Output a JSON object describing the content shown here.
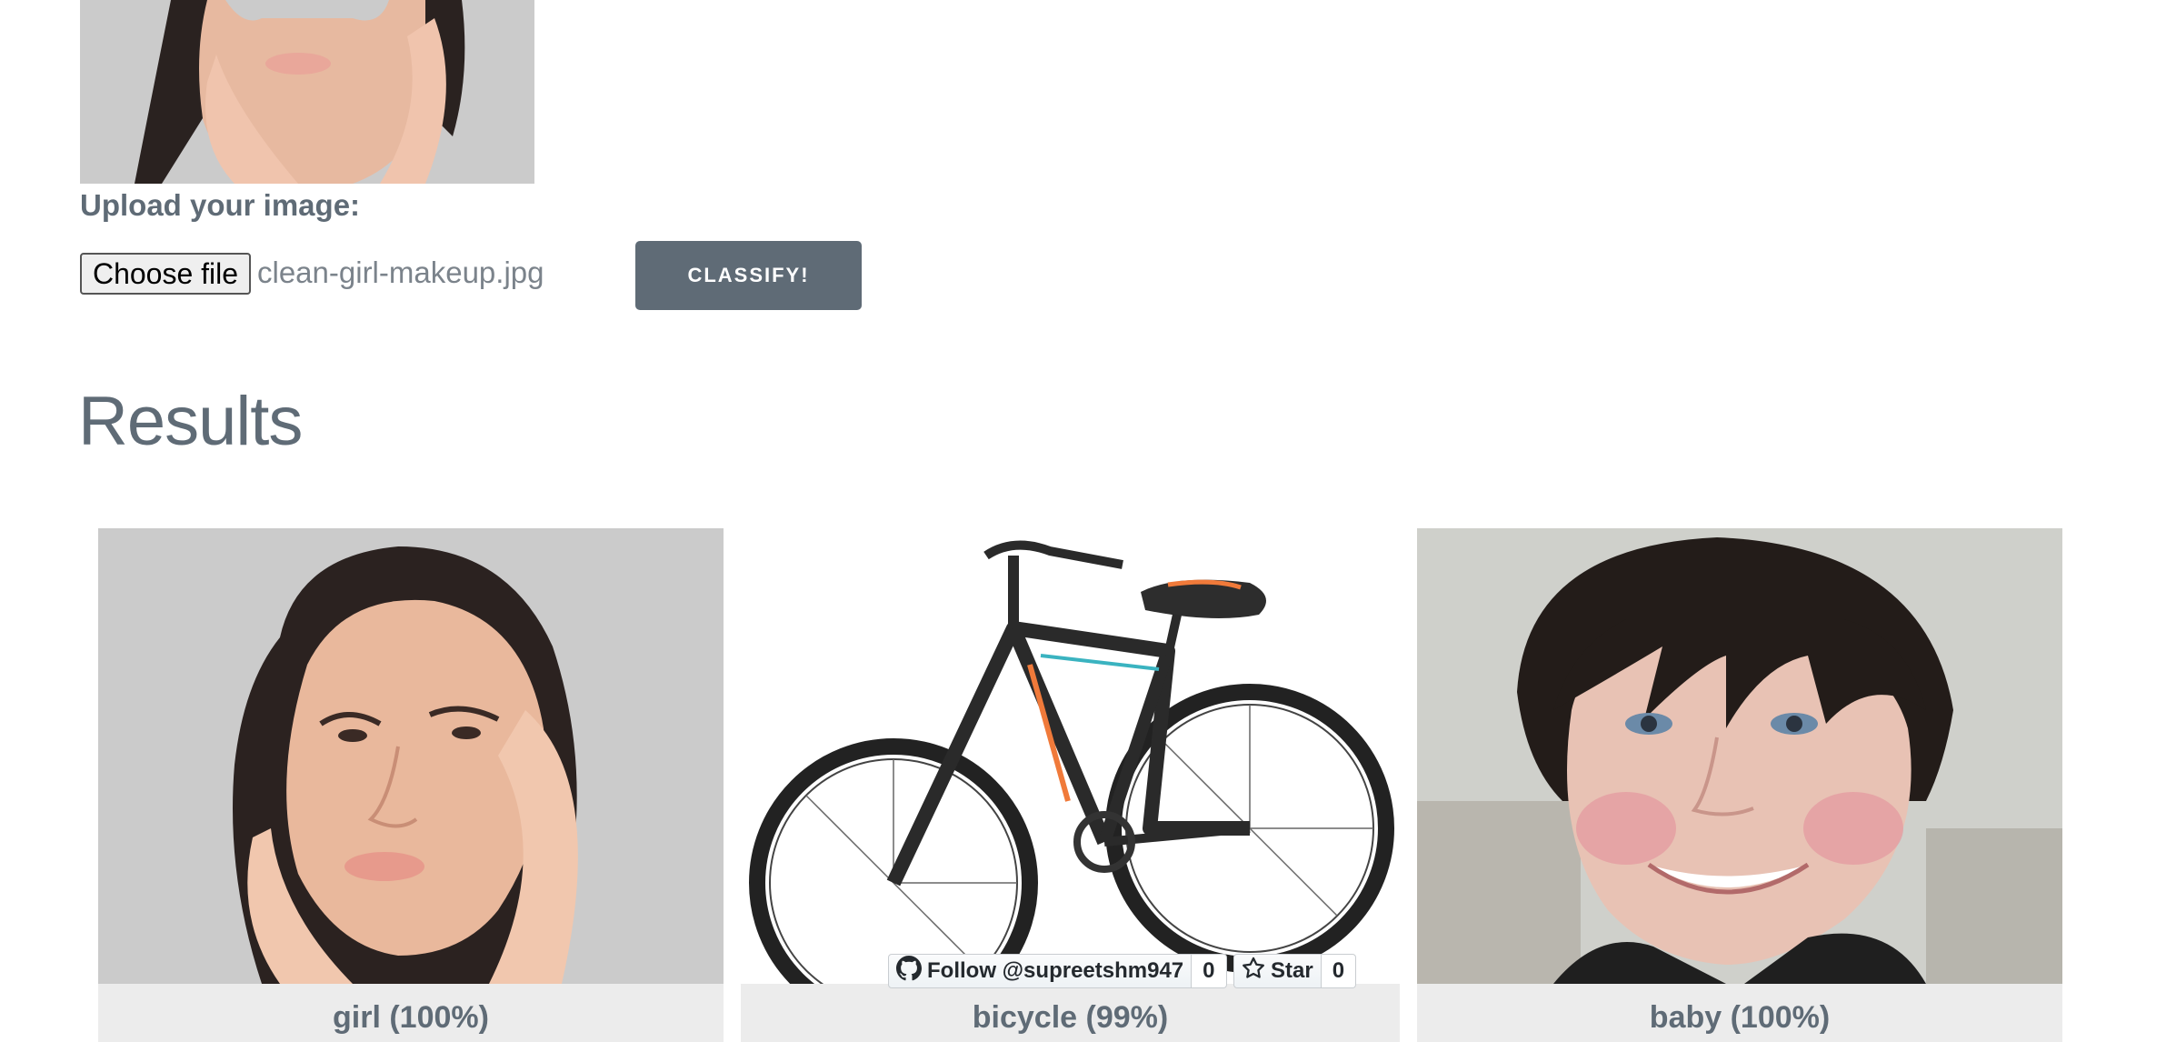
{
  "upload": {
    "label": "Upload your image:",
    "file_button_label": "Choose file",
    "file_name": "clean-girl-makeup.jpg",
    "classify_label": "CLASSIFY!"
  },
  "results": {
    "title": "Results",
    "cards": [
      {
        "caption": "girl (100%)",
        "image": "portrait of a woman touching her face"
      },
      {
        "caption": "bicycle (99%)",
        "image": "black and orange mountain bike"
      },
      {
        "caption": "baby (100%)",
        "image": "smiling child with dark hair"
      }
    ]
  },
  "github": {
    "follow_label": "Follow @supreetshm947",
    "follow_count": "0",
    "star_label": "Star",
    "star_count": "0"
  },
  "icons": {
    "github": "github-icon",
    "star": "star-icon"
  },
  "colors": {
    "text": "#5f6b76",
    "button": "#5f6b76",
    "caption_bg": "#ececec"
  }
}
